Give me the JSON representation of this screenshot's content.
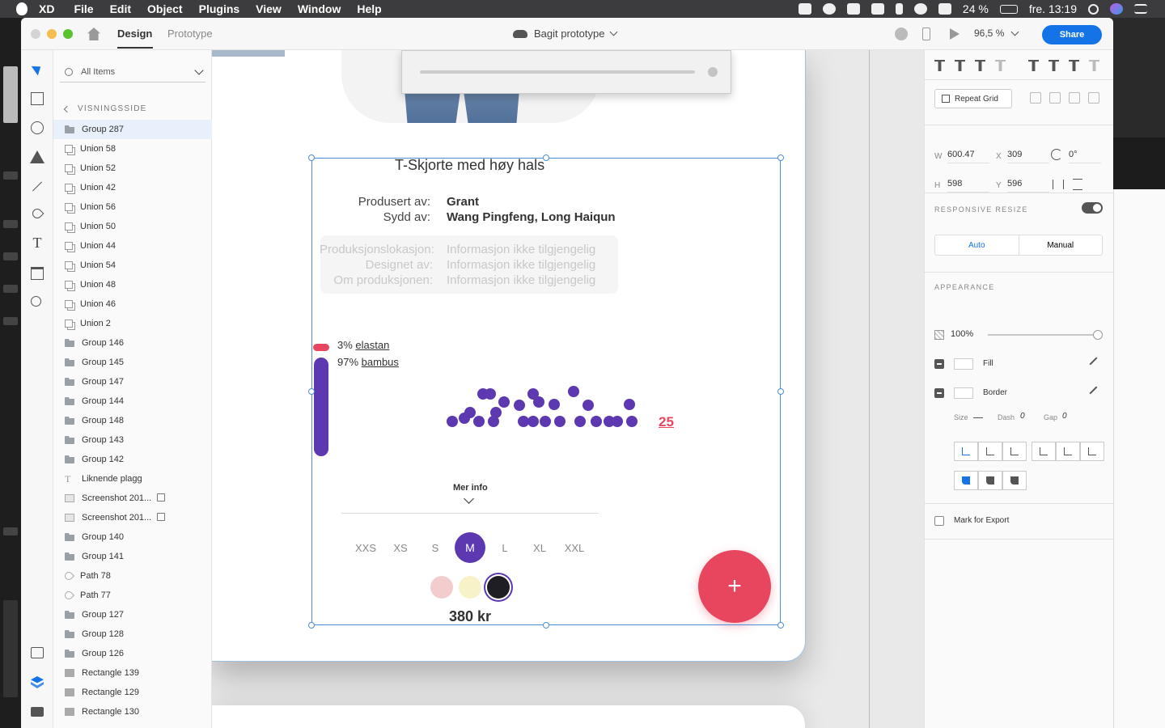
{
  "menubar": {
    "app": "XD",
    "items": [
      "File",
      "Edit",
      "Object",
      "Plugins",
      "View",
      "Window",
      "Help"
    ],
    "battery": "24 %",
    "clock": "fre. 13:19"
  },
  "window": {
    "tabs": {
      "design": "Design",
      "prototype": "Prototype"
    },
    "doc_title": "Bagit prototype",
    "zoom": "96,5 %",
    "share": "Share"
  },
  "layers": {
    "search_placeholder": "All Items",
    "breadcrumb": "VISNINGSSIDE",
    "items": [
      {
        "name": "Group 287",
        "type": "folder",
        "selected": true
      },
      {
        "name": "Union 58",
        "type": "union"
      },
      {
        "name": "Union 52",
        "type": "union"
      },
      {
        "name": "Union 42",
        "type": "union"
      },
      {
        "name": "Union 56",
        "type": "union"
      },
      {
        "name": "Union 50",
        "type": "union"
      },
      {
        "name": "Union 44",
        "type": "union"
      },
      {
        "name": "Union 54",
        "type": "union"
      },
      {
        "name": "Union 48",
        "type": "union"
      },
      {
        "name": "Union 46",
        "type": "union"
      },
      {
        "name": "Union 2",
        "type": "union"
      },
      {
        "name": "Group 146",
        "type": "folder"
      },
      {
        "name": "Group 145",
        "type": "folder"
      },
      {
        "name": "Group 147",
        "type": "folder"
      },
      {
        "name": "Group 144",
        "type": "folder"
      },
      {
        "name": "Group 148",
        "type": "folder"
      },
      {
        "name": "Group 143",
        "type": "folder"
      },
      {
        "name": "Group 142",
        "type": "folder"
      },
      {
        "name": "Liknende plagg",
        "type": "text"
      },
      {
        "name": "Screenshot 201...",
        "type": "image",
        "linked": true
      },
      {
        "name": "Screenshot 201...",
        "type": "image",
        "linked": true
      },
      {
        "name": "Group 140",
        "type": "folder"
      },
      {
        "name": "Group 141",
        "type": "folder"
      },
      {
        "name": "Path 78",
        "type": "path"
      },
      {
        "name": "Path 77",
        "type": "path"
      },
      {
        "name": "Group 127",
        "type": "folder"
      },
      {
        "name": "Group 128",
        "type": "folder"
      },
      {
        "name": "Group 126",
        "type": "folder"
      },
      {
        "name": "Rectangle 139",
        "type": "rect"
      },
      {
        "name": "Rectangle 129",
        "type": "rect"
      },
      {
        "name": "Rectangle 130",
        "type": "rect"
      }
    ]
  },
  "product": {
    "title": "T-Skjorte med høy hals",
    "produced_label": "Produsert av:",
    "produced_value": "Grant",
    "sewn_label": "Sydd av:",
    "sewn_value": "Wang Pingfeng, Long Haiqun",
    "na_rows": [
      {
        "label": "Produksjonslokasjon:",
        "value": "Informasjon ikke tilgjengelig"
      },
      {
        "label": "Designet av:",
        "value": "Informasjon ikke tilgjengelig"
      },
      {
        "label": "Om produksjonen:",
        "value": "Informasjon ikke tilgjengelig"
      }
    ],
    "materials": [
      {
        "pct": "3%",
        "name": "elastan"
      },
      {
        "pct": "97%",
        "name": "bambus"
      }
    ],
    "dot_count": "25",
    "more_info": "Mer info",
    "sizes": [
      "XXS",
      "XS",
      "S",
      "M",
      "L",
      "XL",
      "XXL"
    ],
    "selected_size": "M",
    "swatches": [
      "#f3cdcd",
      "#f7f2c8",
      "#1e1e24"
    ],
    "price": "380 kr",
    "add": "+"
  },
  "inspector": {
    "repeat_grid": "Repeat Grid",
    "w_label": "W",
    "w": "600.47",
    "h_label": "H",
    "h": "598",
    "x_label": "X",
    "x": "309",
    "y_label": "Y",
    "y": "596",
    "rotation": "0°",
    "responsive_resize": "RESPONSIVE RESIZE",
    "auto": "Auto",
    "manual": "Manual",
    "appearance": "APPEARANCE",
    "opacity": "100%",
    "fill": "Fill",
    "border": "Border",
    "size_label": "Size",
    "dash_label": "Dash",
    "dash": "0",
    "gap_label": "Gap",
    "gap": "0",
    "export": "Mark for Export"
  },
  "colors": {
    "accent": "#1473e6",
    "brand_purple": "#5c39b0",
    "brand_red": "#e8465f"
  }
}
